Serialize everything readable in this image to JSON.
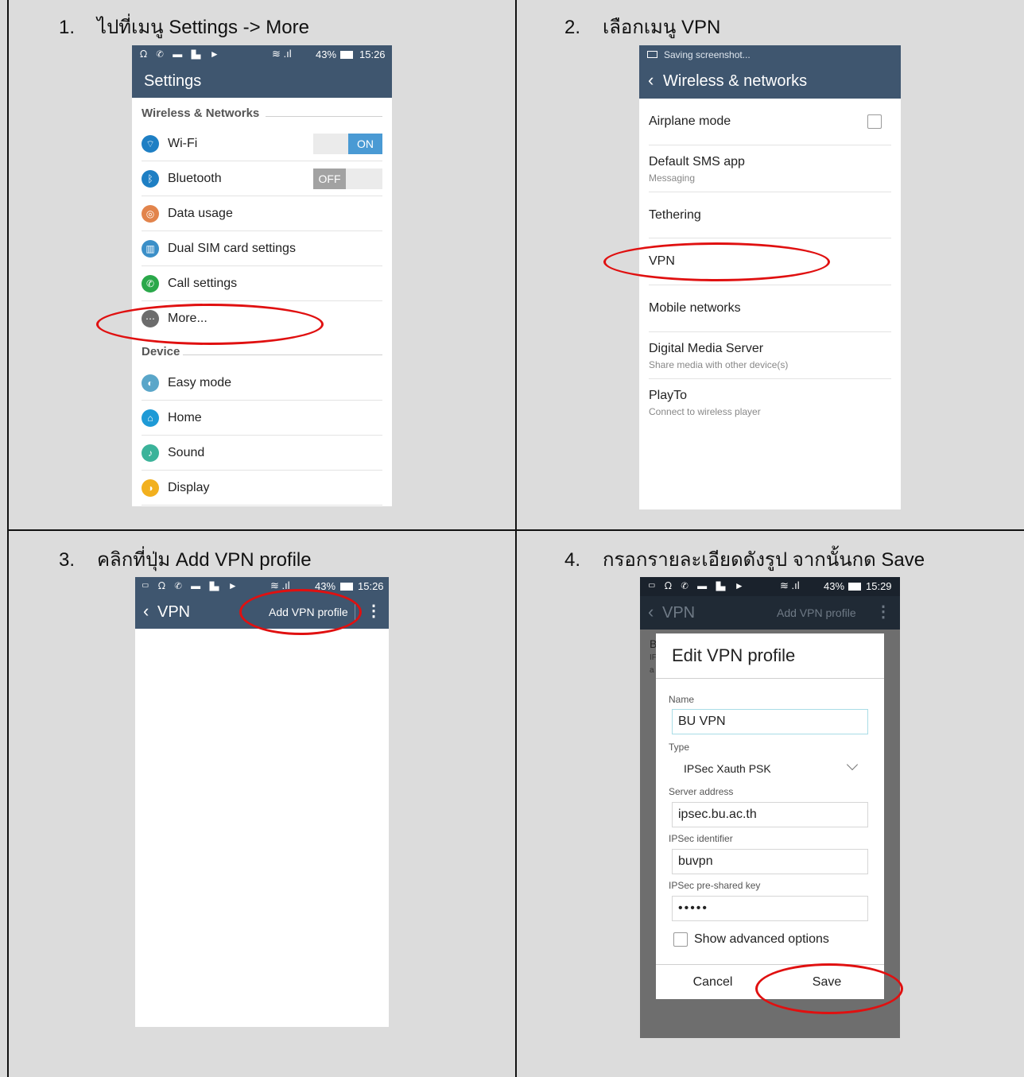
{
  "steps": [
    {
      "number": "1.",
      "title": "ไปที่เมนู Settings -> More"
    },
    {
      "number": "2.",
      "title": "เลือกเมนู VPN"
    },
    {
      "number": "3.",
      "title": "คลิกที่ปุ่ม Add VPN profile"
    },
    {
      "number": "4.",
      "title": "กรอกรายละเอียดดังรูป จากนั้นกด Save"
    }
  ],
  "screen1": {
    "status_right": "43%",
    "time": "15:26",
    "title": "Settings",
    "section_wireless": "Wireless & Networks",
    "items_wireless": [
      {
        "label": "Wi-Fi",
        "icon": "wifi-icon",
        "color": "#1e7fc4",
        "toggle": "ON"
      },
      {
        "label": "Bluetooth",
        "icon": "bluetooth-icon",
        "color": "#1e7fc4",
        "toggle": "OFF"
      },
      {
        "label": "Data usage",
        "icon": "data-usage-icon",
        "color": "#e2844c"
      },
      {
        "label": "Dual SIM card settings",
        "icon": "sim-card-icon",
        "color": "#3b8fc8"
      },
      {
        "label": "Call settings",
        "icon": "phone-icon",
        "color": "#2aa84a"
      },
      {
        "label": "More...",
        "icon": "more-icon",
        "color": "#6c6c6c"
      }
    ],
    "section_device": "Device",
    "items_device": [
      {
        "label": "Easy mode",
        "icon": "easy-mode-icon",
        "color": "#5aa6c9"
      },
      {
        "label": "Home",
        "icon": "home-icon",
        "color": "#1e9ad6"
      },
      {
        "label": "Sound",
        "icon": "sound-icon",
        "color": "#3bb39a"
      },
      {
        "label": "Display",
        "icon": "display-icon",
        "color": "#f2b01e"
      }
    ]
  },
  "screen2": {
    "status_text": "Saving screenshot...",
    "title": "Wireless & networks",
    "items": [
      {
        "title": "Airplane mode",
        "subtitle": "",
        "checkbox": true
      },
      {
        "title": "Default SMS app",
        "subtitle": "Messaging"
      },
      {
        "title": "Tethering",
        "subtitle": ""
      },
      {
        "title": "VPN",
        "subtitle": ""
      },
      {
        "title": "Mobile networks",
        "subtitle": ""
      },
      {
        "title": "Digital Media Server",
        "subtitle": "Share media with other device(s)"
      },
      {
        "title": "PlayTo",
        "subtitle": "Connect to wireless player"
      }
    ]
  },
  "screen3": {
    "status_right": "43%",
    "time": "15:26",
    "title": "VPN",
    "add_button": "Add VPN profile"
  },
  "screen4": {
    "status_right": "43%",
    "time": "15:29",
    "title": "VPN",
    "add_button": "Add VPN profile",
    "behind_letters": [
      "B",
      "IF",
      "a"
    ],
    "dialog": {
      "title": "Edit VPN profile",
      "name_label": "Name",
      "name_value": "BU VPN",
      "type_label": "Type",
      "type_value": "IPSec Xauth PSK",
      "server_label": "Server address",
      "server_value": "ipsec.bu.ac.th",
      "identifier_label": "IPSec identifier",
      "identifier_value": "buvpn",
      "psk_label": "IPSec pre-shared key",
      "psk_value": "•••••",
      "advanced_label": "Show advanced options",
      "cancel_label": "Cancel",
      "save_label": "Save"
    }
  },
  "colors": {
    "action_bar": "#3f566f",
    "highlight_ellipse": "#e01010",
    "toggle_on": "#4a9ad4"
  }
}
